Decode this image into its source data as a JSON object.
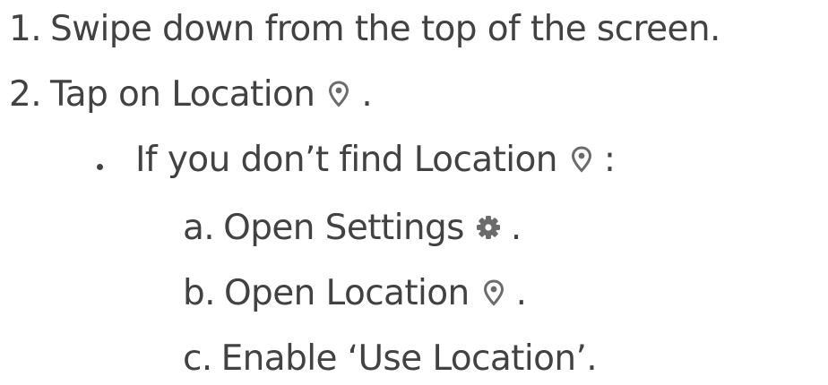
{
  "steps": [
    {
      "num": "1.",
      "text": "Swipe down from the top of the screen."
    },
    {
      "num": "2.",
      "text": "Tap on Location",
      "icon": "location-pin-icon",
      "after": "."
    }
  ],
  "substep": {
    "text": "If you don’t find Location",
    "icon": "location-pin-icon",
    "after": ":"
  },
  "subitems": [
    {
      "label": "a.",
      "text": "Open Settings",
      "icon": "gear-icon",
      "after": "."
    },
    {
      "label": "b.",
      "text": "Open Location",
      "icon": "location-pin-icon",
      "after": "."
    },
    {
      "label": "c.",
      "text": "Enable ‘Use Location’."
    }
  ],
  "colors": {
    "text": "#424242",
    "icon": "#6b6b6b"
  }
}
